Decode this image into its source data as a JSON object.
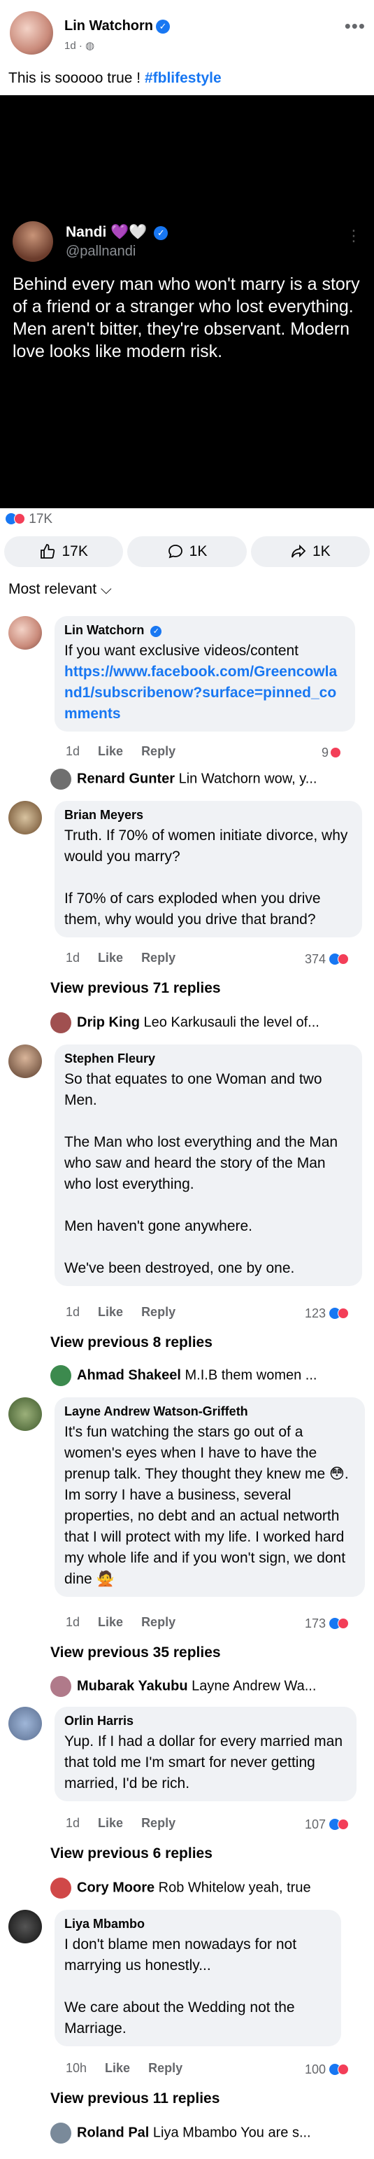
{
  "post": {
    "author": "Lin Watchorn",
    "meta": "1d ·",
    "caption": "This is sooooo true ! ",
    "hashtag": "#fblifestyle"
  },
  "quote": {
    "name": "Nandi 💜🤍",
    "handle": "@pallnandi",
    "text": "Behind every man who won't marry is a story of a friend or a stranger who lost everything. Men aren't bitter, they're observant.  Modern love looks like modern risk."
  },
  "reactions": {
    "count": "17K",
    "like_label": "17K",
    "comment_label": "1K",
    "share_label": "1K"
  },
  "sort_label": "Most relevant",
  "comments": [
    {
      "name": "Lin Watchorn",
      "text": "If you want exclusive videos/content ",
      "link": "https://www.facebook.com/Greencowland1/subscribenow?surface=pinned_comments",
      "time": "1d",
      "like": "Like",
      "reply": "Reply",
      "count": "9",
      "reply_preview_name": "Renard Gunter",
      "reply_preview_text": " Lin Watchorn wow, y..."
    },
    {
      "name": "Brian Meyers",
      "text": "Truth. If 70% of women initiate divorce, why would you marry?\n\nIf 70% of cars exploded when you drive them, why would you drive that brand?",
      "time": "1d",
      "like": "Like",
      "reply": "Reply",
      "count": "374",
      "view_prev": "View previous 71 replies",
      "reply_preview_name": "Drip King",
      "reply_preview_text": " Leo Karkusauli the level of..."
    },
    {
      "name": "Stephen Fleury",
      "text": "So that equates to one Woman and two Men.\n\nThe Man who lost everything and the Man who saw and heard the story of the Man who lost everything.\n\nMen haven't gone anywhere.\n\nWe've been destroyed, one by one.",
      "time": "1d",
      "like": "Like",
      "reply": "Reply",
      "count": "123",
      "view_prev": "View previous 8 replies",
      "reply_preview_name": "Ahmad Shakeel",
      "reply_preview_text": " M.I.B them women ..."
    },
    {
      "name": "Layne Andrew Watson-Griffeth",
      "text": "It's fun watching the stars go out of a women's eyes when I have to have the prenup talk. They thought they knew me 😳. Im sorry I have a business, several properties, no debt and an actual networth that I will protect with my life. I worked hard my whole life and if you won't sign, we dont dine 🙅",
      "time": "1d",
      "like": "Like",
      "reply": "Reply",
      "count": "173",
      "view_prev": "View previous 35 replies",
      "reply_preview_name": "Mubarak Yakubu",
      "reply_preview_text": " Layne Andrew Wa..."
    },
    {
      "name": "Orlin Harris",
      "text": "Yup. If I had a dollar for every married man that told me I'm smart for never getting married, I'd be rich.",
      "time": "1d",
      "like": "Like",
      "reply": "Reply",
      "count": "107",
      "view_prev": "View previous 6 replies",
      "reply_preview_name": "Cory Moore",
      "reply_preview_text": " Rob Whitelow yeah, true"
    },
    {
      "name": "Liya Mbambo",
      "text": "I don't blame men nowadays for not marrying us honestly...\n\nWe care about the Wedding not the Marriage.",
      "time": "10h",
      "like": "Like",
      "reply": "Reply",
      "count": "100",
      "view_prev": "View previous 11 replies",
      "reply_preview_name": "Roland Pal",
      "reply_preview_text": " Liya Mbambo You are s..."
    }
  ]
}
